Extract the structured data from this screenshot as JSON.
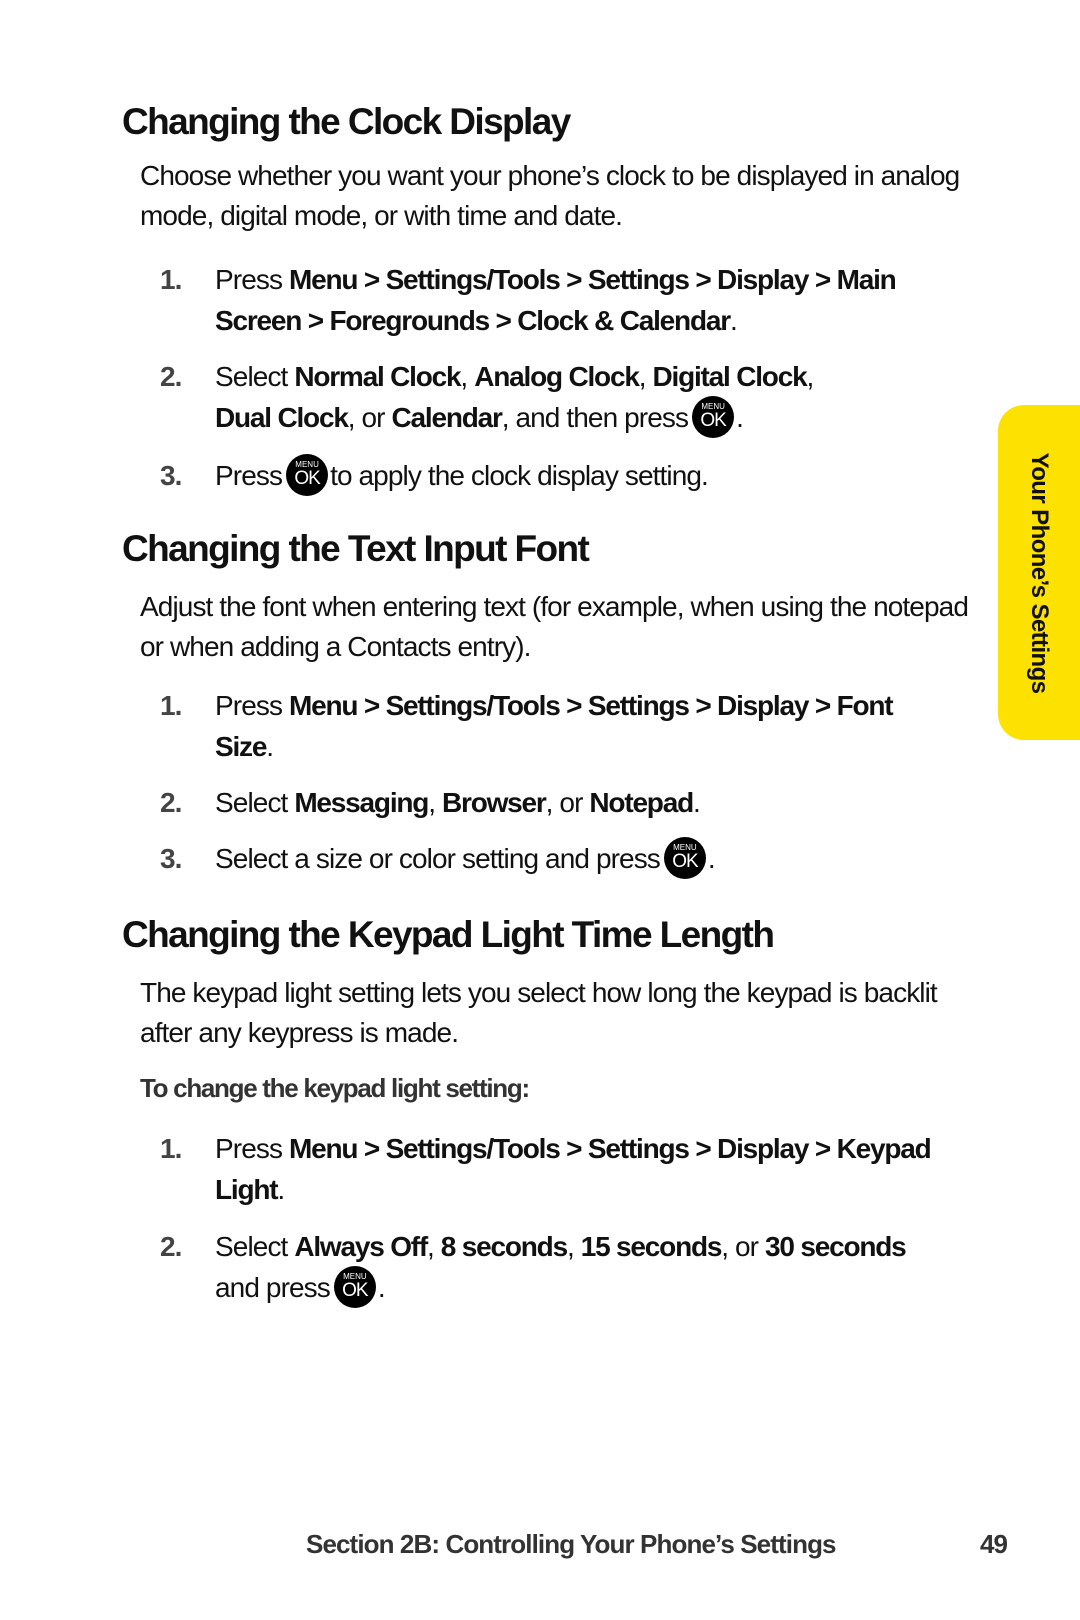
{
  "side_tab": {
    "label": "Your Phone’s Settings",
    "color": "#fde100"
  },
  "ok_button": {
    "top_label": "MENU",
    "main_label": "OK"
  },
  "sections": [
    {
      "title": "Changing the Clock Display",
      "intro": "Choose whether you want your phone’s clock to be displayed in analog mode, digital mode, or with time and date.",
      "steps": [
        {
          "num": "1.",
          "pre": "Press ",
          "bold": "Menu > Settings/Tools > Settings > Display > Main Screen > Foregrounds > Clock & Calendar",
          "post": "."
        },
        {
          "num": "2.",
          "pre": "Select ",
          "b1": "Normal Clock",
          "s1": ", ",
          "b2": "Analog Clock",
          "s2": ", ",
          "b3": "Digital Clock",
          "s3": ", ",
          "b4": "Dual Clock",
          "s4": ", or ",
          "b5": "Calendar",
          "post": ", and then press",
          "end": "."
        },
        {
          "num": "3.",
          "pre": "Press",
          "post": "to apply the clock display setting."
        }
      ]
    },
    {
      "title": "Changing the Text Input Font",
      "intro": "Adjust the font when entering text (for example, when using the notepad or when adding a Contacts entry).",
      "steps": [
        {
          "num": "1.",
          "pre": "Press ",
          "bold": "Menu > Settings/Tools > Settings > Display > Font Size",
          "post": "."
        },
        {
          "num": "2.",
          "pre": "Select ",
          "b1": "Messaging",
          "s1": ", ",
          "b2": "Browser",
          "s2": ", or ",
          "b3": "Notepad",
          "post": "."
        },
        {
          "num": "3.",
          "pre": "Select a size or color setting and press",
          "end": "."
        }
      ]
    },
    {
      "title": "Changing the Keypad Light Time Length",
      "intro": "The keypad light setting lets you select how long the keypad is backlit after any keypress is made.",
      "sublabel": "To change the keypad light setting:",
      "steps": [
        {
          "num": "1.",
          "pre": "Press ",
          "bold": "Menu > Settings/Tools > Settings > Display > Keypad Light",
          "post": "."
        },
        {
          "num": "2.",
          "pre": "Select ",
          "b1": "Always Off",
          "s1": ", ",
          "b2": "8 seconds",
          "s2": ", ",
          "b3": "15 seconds",
          "s3": ", or ",
          "b4": "30 seconds",
          "post": " and press",
          "end": "."
        }
      ]
    }
  ],
  "footer": {
    "section": "Section 2B: Controlling Your Phone’s Settings",
    "page_number": "49"
  }
}
